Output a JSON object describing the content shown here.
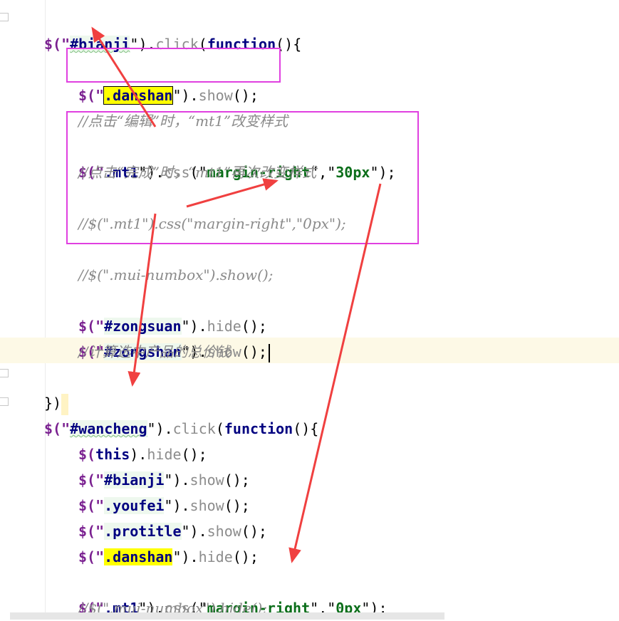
{
  "editor": {
    "lines": [
      {
        "id": "l1",
        "parts": [
          "$(\"",
          "#bianji",
          "\").",
          "click",
          "(",
          "function",
          "(){"
        ]
      },
      {
        "id": "l2",
        "parts": [
          "$(\"",
          ".danshan",
          "\").",
          "show",
          "();"
        ]
      },
      {
        "id": "l3",
        "text": "//点击“编辑”时，“mt1”改变样式"
      },
      {
        "id": "l4",
        "parts": [
          "$(\"",
          ".mt1",
          "\").",
          "css",
          "(\"",
          "margin-right",
          "\",\"",
          "30px",
          "\");"
        ]
      },
      {
        "id": "l5",
        "text": "//点击“完成”时，“mt1”再次改变样式"
      },
      {
        "id": "l6",
        "text": "//$(\".mt1\").css(\"margin-right\",\"0px\");"
      },
      {
        "id": "l7",
        "text": "//$(\".mui-numbox\").show();"
      },
      {
        "id": "l8",
        "parts": [
          "$(\"",
          "#zongsuan",
          "\").",
          "hide",
          "();"
        ]
      },
      {
        "id": "l9",
        "parts": [
          "$(\"",
          "#zongshan",
          "\").",
          "show",
          "();"
        ]
      },
      {
        "id": "l10",
        "text": "//计算选中产品的总价钱"
      },
      {
        "id": "l11",
        "text": "})"
      },
      {
        "id": "l12",
        "parts": [
          "$(\"",
          "#wancheng",
          "\").",
          "click",
          "(",
          "function",
          "(){"
        ]
      },
      {
        "id": "l13",
        "parts": [
          "$(",
          "this",
          ").",
          "hide",
          "();"
        ]
      },
      {
        "id": "l14",
        "parts": [
          "$(\"",
          "#bianji",
          "\").",
          "show",
          "();"
        ]
      },
      {
        "id": "l15",
        "parts": [
          "$(\"",
          ".youfei",
          "\").",
          "show",
          "();"
        ]
      },
      {
        "id": "l16",
        "parts": [
          "$(\"",
          ".protitle",
          "\").",
          "show",
          "();"
        ]
      },
      {
        "id": "l17",
        "parts": [
          "$(\"",
          ".danshan",
          "\").",
          "hide",
          "();"
        ]
      },
      {
        "id": "l18",
        "parts": [
          "$(\"",
          ".mt1",
          "\").",
          "css",
          "(\"",
          "margin-right",
          "\",\"",
          "0px",
          "\");"
        ]
      },
      {
        "id": "l19",
        "text": "//$(\".mui-numbox\").hide();"
      }
    ]
  },
  "colors": {
    "annotation_box": "#e040e0",
    "arrow": "#f04040",
    "highlight": "#ffff00",
    "current_line": "#fdf9e6"
  },
  "icons": [
    "fold-marker-icon",
    "arrow-annotation-icon"
  ]
}
